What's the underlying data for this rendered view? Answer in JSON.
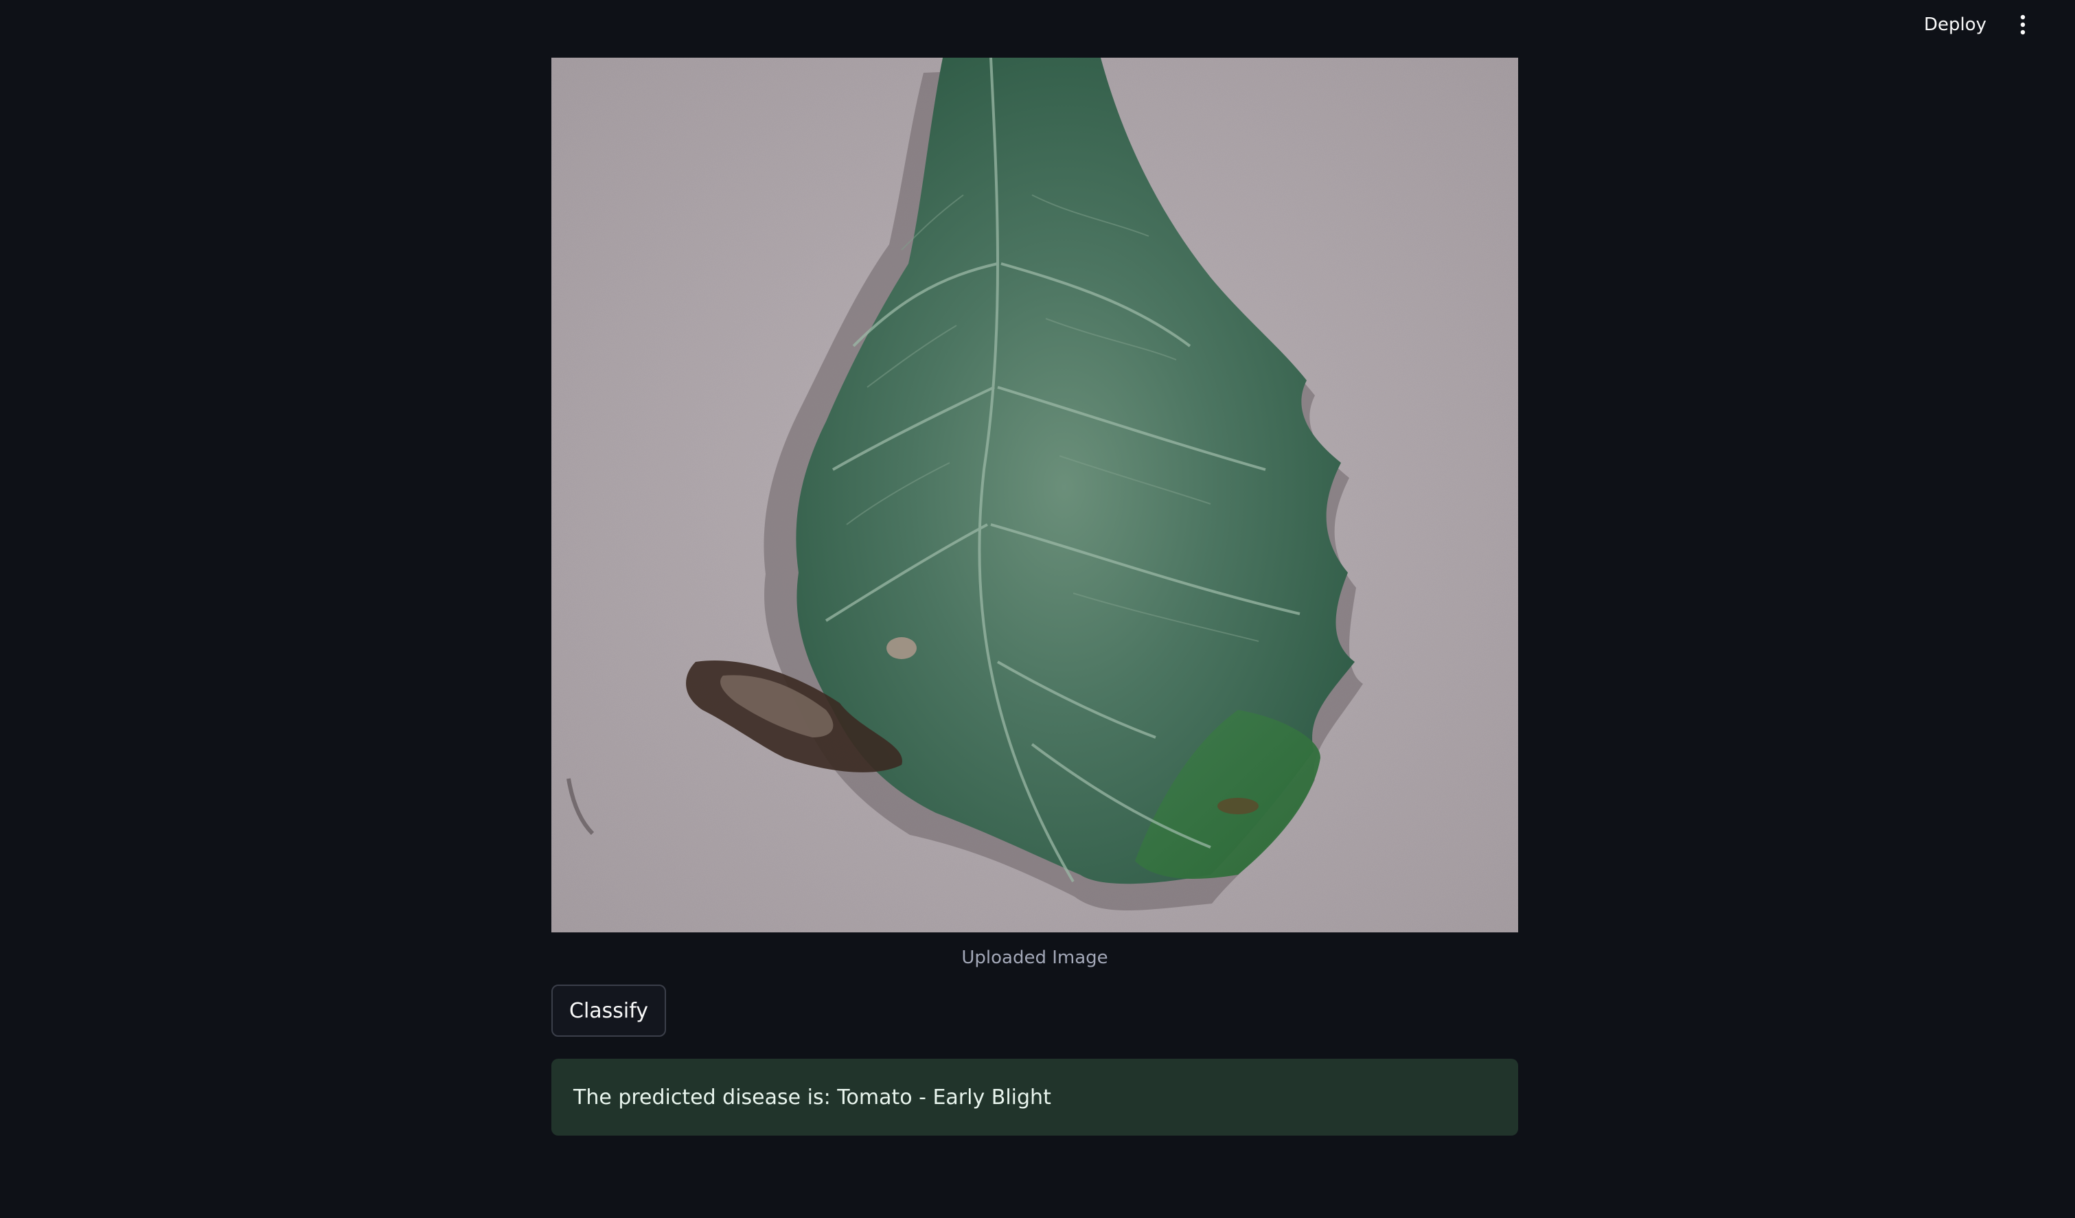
{
  "header": {
    "deploy_label": "Deploy",
    "menu_icon": "kebab-menu-icon"
  },
  "image": {
    "caption": "Uploaded Image",
    "subject_icon": "tomato-leaf-photo"
  },
  "actions": {
    "classify_label": "Classify"
  },
  "result": {
    "message": "The predicted disease is: Tomato - Early Blight"
  },
  "colors": {
    "background": "#0e1117",
    "success_bg": "#21342b",
    "text": "#fafafa",
    "caption": "#a3a8b8"
  }
}
